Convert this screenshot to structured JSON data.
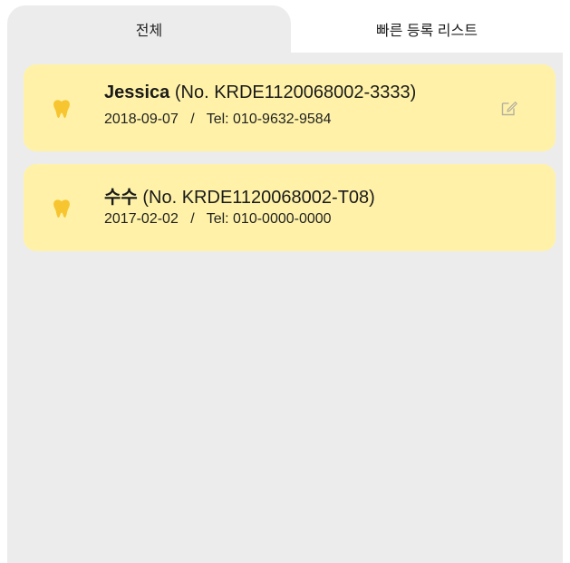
{
  "tabs": {
    "all_label": "전체",
    "quick_list_label": "빠른 등록 리스트"
  },
  "colors": {
    "card_bg": "#fff2a8",
    "tooth": "#f7c530",
    "panel_bg": "#ececec"
  },
  "patients": [
    {
      "name": "Jessica",
      "number": "(No. KRDE1120068002-3333)",
      "birth": "2018-09-07",
      "separator": "/",
      "tel": "Tel: 010-9632-9584",
      "icon": "tooth-icon",
      "has_edit": true
    },
    {
      "name": "수수",
      "number": "(No. KRDE1120068002-T08)",
      "birth": "2017-02-02",
      "separator": "/",
      "tel": "Tel: 010-0000-0000",
      "icon": "tooth-icon",
      "has_edit": false
    }
  ]
}
